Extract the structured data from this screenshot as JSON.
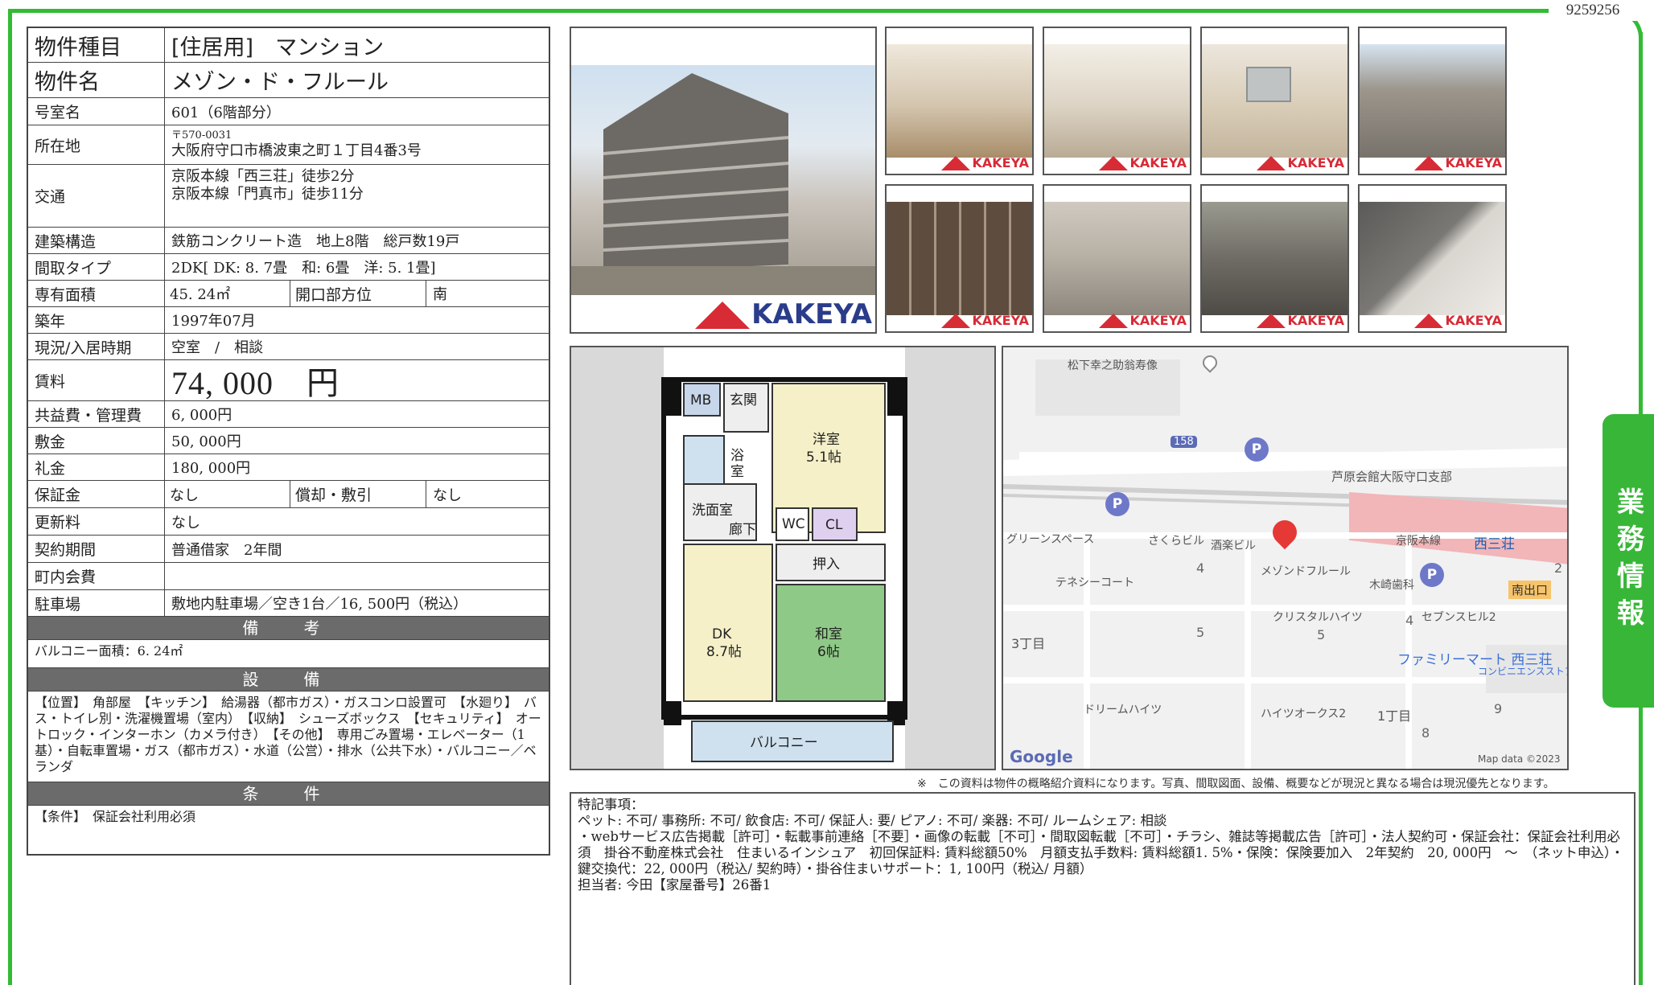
{
  "property_id": "9259256",
  "side_tab": "業務情報",
  "info": {
    "type_label": "物件種目",
    "type_value": "[住居用]　マンション",
    "name_label": "物件名",
    "name_value": "メゾン・ド・フルール",
    "room_label": "号室名",
    "room_value": "601（6階部分）",
    "address_label": "所在地",
    "postal": "〒570-0031",
    "address_value": "大阪府守口市橋波東之町１丁目4番3号",
    "transport_label": "交通",
    "transport_1": "京阪本線「西三荘」徒歩2分",
    "transport_2": "京阪本線「門真市」徒歩11分",
    "structure_label": "建築構造",
    "structure_value": "鉄筋コンクリート造　地上8階　総戸数19戸",
    "layout_label": "間取タイプ",
    "layout_value": "2DK[ DK: 8. 7畳　和: 6畳　洋: 5. 1畳]",
    "area_label": "専有面積",
    "area_value": "45. 24㎡",
    "direction_label": "開口部方位",
    "direction_value": "南",
    "built_label": "築年",
    "built_value": "1997年07月",
    "status_label": "現況/入居時期",
    "status_value": "空室　/　相談",
    "rent_label": "賃料",
    "rent_value": "74, 000　円",
    "fee_label": "共益費・管理費",
    "fee_value": "6, 000円",
    "deposit_label": "敷金",
    "deposit_value": "50, 000円",
    "key_money_label": "礼金",
    "key_money_value": "180, 000円",
    "guarantee_label": "保証金",
    "guarantee_value": "なし",
    "amortization_label": "償却・敷引",
    "amortization_value": "なし",
    "renewal_label": "更新料",
    "renewal_value": "なし",
    "contract_label": "契約期間",
    "contract_value": "普通借家　2年間",
    "community_label": "町内会費",
    "community_value": "",
    "parking_label": "駐車場",
    "parking_value": "敷地内駐車場／空き1台／16, 500円（税込）"
  },
  "remarks": {
    "heading": "備　考",
    "text": "バルコニー面積：6. 24㎡"
  },
  "facilities": {
    "heading": "設　備",
    "text": "【位置】　角部屋　【キッチン】　給湯器（都市ガス）・ガスコンロ設置可　【水廻り】　バス・トイレ別・洗濯機置場（室内）　【収納】　シューズボックス　【セキュリティ】　オートロック・インターホン（カメラ付き）　【その他】　専用ごみ置場・エレベーター（1基）・自転車置場・ガス（都市ガス）・水道（公営）・排水（公共下水）・バルコニー／ベランダ"
  },
  "conditions": {
    "heading": "条　件",
    "text": "【条件】　保証会社利用必須"
  },
  "photos": {
    "logo_text": "KAKEYA",
    "count_thumbs": 8
  },
  "floorplan": {
    "rooms": [
      "MB",
      "玄関",
      "浴室",
      "洗面室",
      "廊下",
      "洋室 5.1帖",
      "WC",
      "CL",
      "押入",
      "DK 8.7帖",
      "和室 6帖",
      "バルコニー"
    ]
  },
  "map": {
    "labels": [
      "松下幸之助翁寿像",
      "芦原会館大阪守口支部",
      "グリーンスペース",
      "さくらビル",
      "酒楽ビル",
      "メゾンドフルール",
      "京阪本線",
      "西三荘",
      "木崎歯科",
      "テネシーコート",
      "クリスタルハイツ",
      "セブンスヒル2",
      "南出口",
      "ファミリーマート 西三荘",
      "コンビニエンスストア",
      "3丁目",
      "ドリームハイツ",
      "ハイツオークス2",
      "1丁目"
    ],
    "numbers": [
      "158",
      "4",
      "5",
      "5",
      "4",
      "2",
      "9",
      "8"
    ],
    "brand": "Google",
    "credit": "Map data ©2023"
  },
  "disclaimer": "※　この資料は物件の概略紹介資料になります。写真、間取図面、設備、概要などが現況と異なる場合は現況優先となります。",
  "notes": {
    "line1": "特記事項：",
    "line2": "ペット: 不可/ 事務所: 不可/ 飲食店: 不可/ 保証人: 要/ ピアノ: 不可/ 楽器: 不可/ ルームシェア: 相談",
    "line3": "・webサービス広告掲載［許可］・転載事前連絡［不要］・画像の転載［不可］・間取図転載［不可］・チラシ、雑誌等掲載広告［許可］・法人契約可・保証会社：保証会社利用必須　掛谷不動産株式会社　住まいるインシュア　初回保証料: 賃料総額50%　月額支払手数料: 賃料総額1. 5%・保険：保険要加入　2年契約　20, 000円　～　（ネット申込）・鍵交換代：22, 000円（税込/ 契約時）・掛谷住まいサポート：1, 100円（税込/ 月額）",
    "line4": "担当者: 今田【家屋番号】26番1"
  }
}
